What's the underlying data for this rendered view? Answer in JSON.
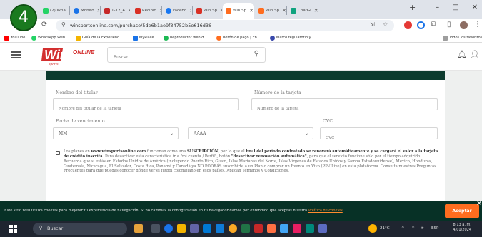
{
  "badge": "4",
  "tabs": [
    {
      "label": "(2) Wha",
      "color": "#25d366"
    },
    {
      "label": "Monito",
      "color": "#1a73e8"
    },
    {
      "label": "1-12_A",
      "color": "#c62828"
    },
    {
      "label": "Recibid",
      "color": "#d93025"
    },
    {
      "label": "Facebo",
      "color": "#1877f2"
    },
    {
      "label": "Win Sp",
      "color": "#d93025"
    },
    {
      "label": "Win Sp",
      "color": "#ff6d1f"
    },
    {
      "label": "Win Sp",
      "color": "#ff6d1f"
    },
    {
      "label": "ChatGI",
      "color": "#10a37f"
    }
  ],
  "window": {
    "minimize": "–",
    "maximize": "□",
    "close": "✕"
  },
  "url": "winsportsonline.com/purchase/5de6b1ae9f34752b5e616d36",
  "bookmarks": [
    {
      "label": "YouTube",
      "color": "#ff0000"
    },
    {
      "label": "WhatsApp Web",
      "color": "#25d366"
    },
    {
      "label": "Guía de la Experienc...",
      "color": "#f4b400"
    },
    {
      "label": "MyPlace",
      "color": "#1a73e8"
    },
    {
      "label": "Reproductor web d...",
      "color": "#1db954"
    },
    {
      "label": "Botón de pago | En...",
      "color": "#ff6d1f"
    },
    {
      "label": "Marco regulatorio y...",
      "color": "#3949ab"
    }
  ],
  "bookmarks_all": "Todos los favoritos",
  "site": {
    "search_placeholder": "Buscar...",
    "logo_text": "Win",
    "logo_online": "ONLINE",
    "logo_sub": "sports"
  },
  "form": {
    "holder_label": "Nombre del titular",
    "holder_placeholder": "Nombre del titular de la tarjeta",
    "card_label": "Número de la tarjeta",
    "card_placeholder": "Número de la tarjeta",
    "expiry_label": "Fecha de vencimiento",
    "month_value": "MM",
    "year_value": "AAAA",
    "cvc_label": "CVC",
    "cvc_placeholder": "CVC"
  },
  "terms": {
    "p1_a": "Los planes en ",
    "p1_site": "www.winsportsonline.com",
    "p1_b": " funcionan como una ",
    "p1_sub": "SUSCRIPCIÓN",
    "p1_c": ", por lo que al ",
    "p1_bold1": "final del periodo contratado se renovará automáticamente y se cargará el valor a la tarjeta de crédito inscrita",
    "p1_d": ". Para desactivar esta característica ir a \"mi cuenta / Perfil\", botón ",
    "p1_bold2": "\"desactivar renovación automática\"",
    "p1_e": ", para que el servicio funcione sólo por el tiempo adquirido.",
    "p2": "Recuerda que si estás en Estados Unidos de América (incluyendo Puerto Rico, Guam, Islas Marianas del Norte, Islas Vírgenes de Estados Unidos y Samoa Estadounidense), México, Honduras, Guatemala, Nicaragua, El Salvador, Costa Rica, Panamá y Canadá ya NO PODRÁS suscribirte a un Plan o comprar un Evento en Vivo (PPV Live) en esta plataforma. Consulta nuestras Preguntas Frecuentes para que puedas conocer dónde ver el fútbol colombiano en esos países. Aplican Términos y Condiciones."
  },
  "cookie": {
    "text": "Este sitio web utiliza cookies para mejorar tu experiencia de navegación. Si no cambias la configuración en tu navegador damos por entendido que aceptas nuestra ",
    "link": "Política de cookies",
    "accept": "Aceptar"
  },
  "taskbar": {
    "search": "Buscar",
    "temp": "21°C",
    "lang": "ESP",
    "time": "8:13 a. m.",
    "date": "4/01/2024"
  }
}
